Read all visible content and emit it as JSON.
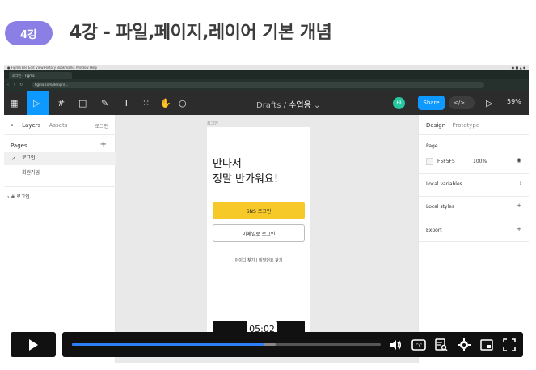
{
  "lesson": {
    "badge": "4강",
    "title": "4강 - 파일,페이지,레이어 기본 개념"
  },
  "browser": {
    "tab_title": "로그인 – Figma",
    "url": "figma.com/design/...",
    "os_bar_right": "●  ■  ▲  ◆"
  },
  "toolbar": {
    "breadcrumb_root": "Drafts",
    "breadcrumb_sep": "/",
    "file_name": "수업용",
    "avatar_initials": "HI",
    "share_label": "Share",
    "dev_mode_label": "</>",
    "zoom": "59%"
  },
  "left_panel": {
    "tab_layers": "Layers",
    "tab_assets": "Assets",
    "page_select": "로그인",
    "pages_heading": "Pages",
    "pages": [
      {
        "label": "로그인",
        "active": true
      },
      {
        "label": "회원가입",
        "active": false
      }
    ],
    "layer_item": "로그인"
  },
  "canvas": {
    "frame_label": "로그인",
    "heading_line1": "만나서",
    "heading_line2": "정말 반가워요!",
    "sns_button": "SNS 로그인",
    "email_button": "이메일로 로그인",
    "links": "아이디 찾기   |   비밀번호 찾기"
  },
  "right_panel": {
    "tab_design": "Design",
    "tab_prototype": "Prototype",
    "page_section": "Page",
    "page_color": "F5F5F5",
    "page_opacity": "100%",
    "local_variables": "Local variables",
    "local_styles": "Local styles",
    "export": "Export"
  },
  "player": {
    "current_time": "05:02",
    "progress": 0.62,
    "buffered": 0.66
  },
  "colors": {
    "badge": "#8b7fe6",
    "accent": "#0d99ff",
    "sns_button": "#f7c928",
    "progress": "#2d7ff9"
  }
}
